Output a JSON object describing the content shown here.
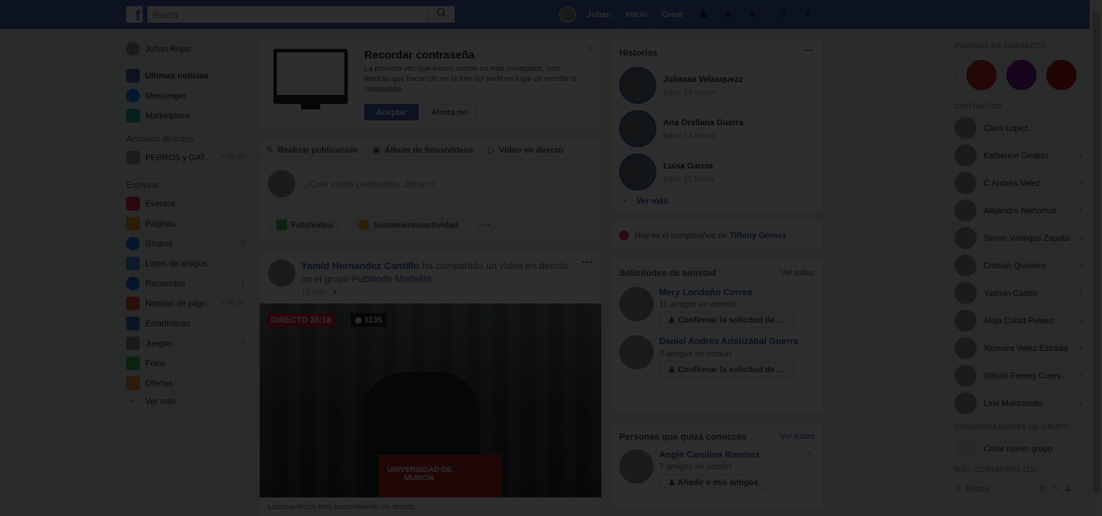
{
  "header": {
    "logo": "f",
    "search_placeholder": "Busca",
    "user": "Johan",
    "nav": [
      "Inicio",
      "Crear"
    ],
    "icons": [
      "friends-icon",
      "messenger-icon",
      "bell-icon",
      "help-icon",
      "chevron-down-icon"
    ]
  },
  "left": {
    "profile": "Johan Rojas",
    "items": [
      {
        "label": "Últimas noticias",
        "more": "···"
      },
      {
        "label": "Messenger"
      },
      {
        "label": "Marketplace"
      }
    ],
    "shortcuts_title": "Accesos directos",
    "shortcuts": [
      {
        "label": "PERROS y GAT...",
        "count": "+ de 20"
      }
    ],
    "explore_title": "Explorar",
    "explore": [
      {
        "label": "Eventos",
        "count": ""
      },
      {
        "label": "Páginas",
        "count": ""
      },
      {
        "label": "Grupos",
        "count": "4"
      },
      {
        "label": "Listas de amigos",
        "count": ""
      },
      {
        "label": "Recuerdos",
        "count": "1"
      },
      {
        "label": "Noticias de pági...",
        "count": "+ de 20"
      },
      {
        "label": "Estadísticas",
        "count": ""
      },
      {
        "label": "Juegos",
        "count": "4"
      },
      {
        "label": "Fotos",
        "count": ""
      },
      {
        "label": "Ofertas",
        "count": ""
      }
    ],
    "see_more": "Ver más"
  },
  "password": {
    "title": "Recordar contraseña",
    "text": "La próxima vez que inicies sesión en este navegador, solo tendrás que hacer clic en la foto del perfil en lugar de escribir la contraseña.",
    "accept": "Aceptar",
    "later": "Ahora no",
    "close": "×"
  },
  "composer": {
    "tabs": [
      "Realizar publicación",
      "Álbum de fotos/vídeos",
      "Vídeo en directo"
    ],
    "placeholder": "¿Qué estás pensando, Johan?",
    "actions": [
      "Foto/vídeo",
      "Sentimiento/actividad"
    ],
    "more": "···"
  },
  "post": {
    "author": "Yamid Hernandez Cantillo",
    "action": "ha compartido un vídeo en directo en el grupo",
    "group": "Publitodo Medellín",
    "time": "13 min",
    "live_badge": "DIRECTO 38:18",
    "viewers": "1135",
    "video_sign": "UNIVERSIDAD DE MURCIA",
    "footer": "Latinoamérica está transmitiendo en directo",
    "more": "···"
  },
  "stories": {
    "title": "Historias",
    "more": "···",
    "items": [
      {
        "name": "Julianaa Velasquezz",
        "time": "hace 18 horas"
      },
      {
        "name": "Ana Orellana Guerra",
        "time": "hace 14 horas"
      },
      {
        "name": "Luisa Garcia",
        "time": "hace 11 horas"
      }
    ],
    "see_more": "Ver más"
  },
  "birthday": {
    "prefix": "Hoy es el cumpleaños de",
    "name": "Tiffany Gómez"
  },
  "requests": {
    "title": "Solicitudes de amistad",
    "see_all": "Ver todas",
    "items": [
      {
        "name": "Mery Londoño Correa",
        "mutual": "11 amigos en común",
        "button": "Confirmar la solicitud de ..."
      },
      {
        "name": "Daniel Andrés Aristizábal Guerra",
        "mutual": "3 amigos en común",
        "button": "Confirmar la solicitud de ..."
      }
    ]
  },
  "pymk": {
    "title": "Personas que quizá conozcas",
    "see_all": "Ver todas",
    "name": "Angie Carolina Ramirez",
    "mutual": "7 amigos en común",
    "button": "Añadir a mis amigos",
    "close": "×"
  },
  "rail": {
    "pages_title": "PÁGINAS DE CONTACTO",
    "contacts_title": "CONTACTOS",
    "contacts": [
      "Clara Lopez",
      "Katherine Giraldo",
      "C Andres Velez",
      "Alejandro Atehortua",
      "Simon Vanegas Zapata",
      "Cristian Quintero",
      "Yasmin Castro",
      "Aleja Calad Pelaez",
      "Xiomara Velez Estrada",
      "Wilson Ferney Cuerv...",
      "Lina Maldonado"
    ],
    "group_title": "CONVERSACIONES DE GRUPO",
    "new_group": "Crear nuevo grupo",
    "more_title": "MÁS CONTACTOS (13)",
    "search_placeholder": "Busca"
  }
}
